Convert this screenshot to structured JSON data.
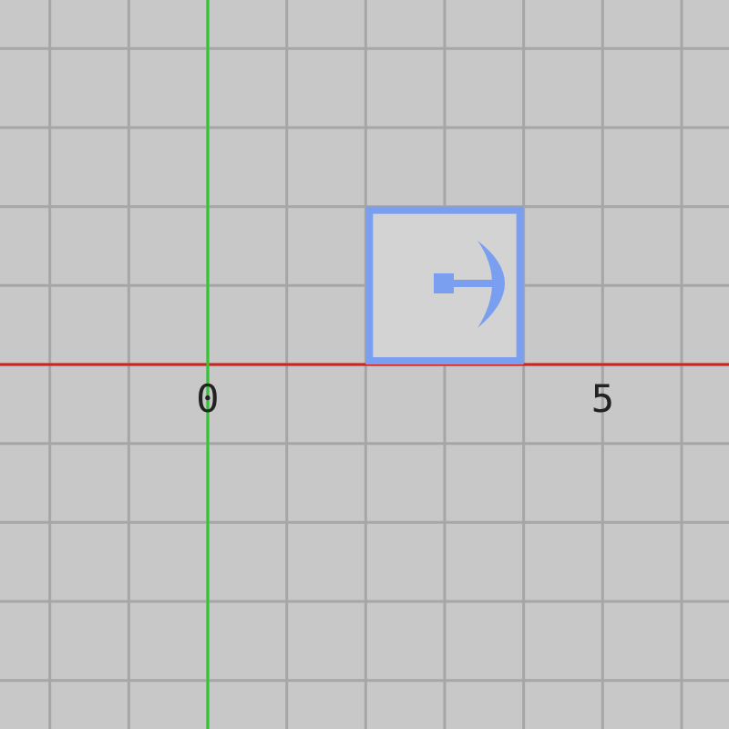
{
  "canvas": {
    "axis_labels": [
      "0",
      "5"
    ],
    "node": {
      "selected": true
    }
  }
}
